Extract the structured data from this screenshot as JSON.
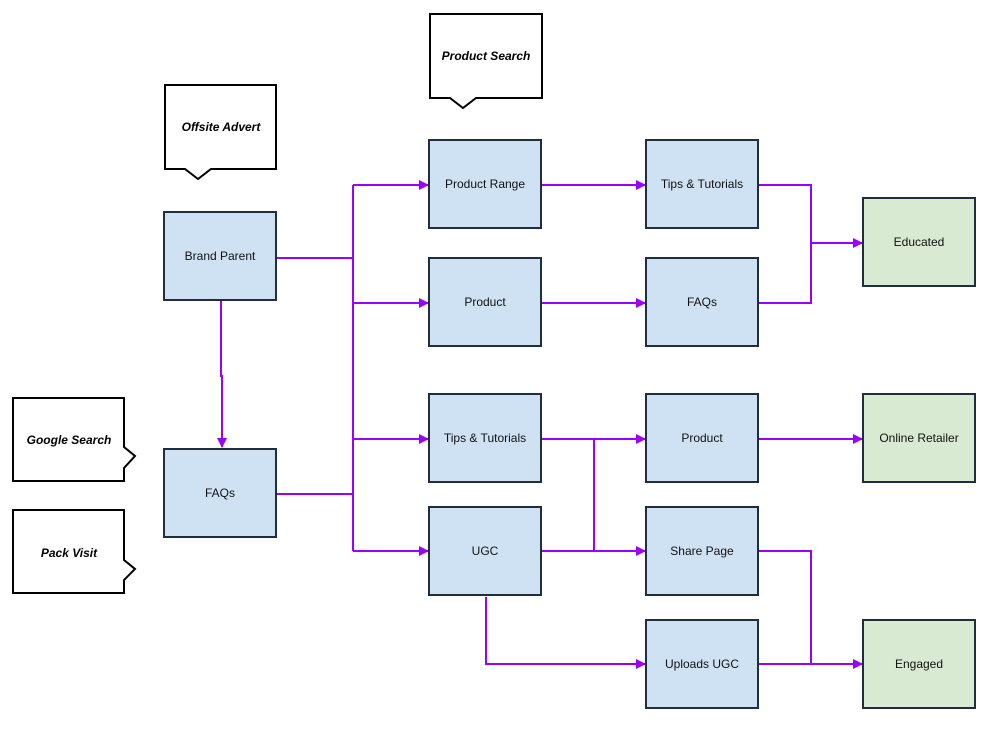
{
  "diagram": {
    "title": "",
    "colors": {
      "page_fill": "#cfe2f3",
      "outcome_fill": "#d9ead3",
      "node_stroke": "#1f2d3d",
      "callout_fill": "#ffffff",
      "callout_stroke": "#000000",
      "connector": "#9900ff"
    },
    "callouts": [
      {
        "id": "product-search",
        "label": "Product Search",
        "pointer": "down"
      },
      {
        "id": "offsite-advert",
        "label": "Offsite Advert",
        "pointer": "down"
      },
      {
        "id": "google-search",
        "label": "Google Search",
        "pointer": "right"
      },
      {
        "id": "pack-visit",
        "label": "Pack Visit",
        "pointer": "right"
      }
    ],
    "nodes": [
      {
        "id": "brand-parent",
        "label": "Brand Parent",
        "kind": "page"
      },
      {
        "id": "faqs-entry",
        "label": "FAQs",
        "kind": "page"
      },
      {
        "id": "product-range",
        "label": "Product Range",
        "kind": "page"
      },
      {
        "id": "product-1",
        "label": "Product",
        "kind": "page"
      },
      {
        "id": "tips-tutorials-1",
        "label": "Tips & Tutorials",
        "kind": "page"
      },
      {
        "id": "ugc",
        "label": "UGC",
        "kind": "page"
      },
      {
        "id": "tips-tutorials-2",
        "label": "Tips & Tutorials",
        "kind": "page"
      },
      {
        "id": "faqs-2",
        "label": "FAQs",
        "kind": "page"
      },
      {
        "id": "product-2",
        "label": "Product",
        "kind": "page"
      },
      {
        "id": "share-page",
        "label": "Share Page",
        "kind": "page"
      },
      {
        "id": "uploads-ugc",
        "label": "Uploads UGC",
        "kind": "page"
      },
      {
        "id": "educated",
        "label": "Educated",
        "kind": "outcome"
      },
      {
        "id": "online-retailer",
        "label": "Online Retailer",
        "kind": "outcome"
      },
      {
        "id": "engaged",
        "label": "Engaged",
        "kind": "outcome"
      }
    ],
    "edges": [
      {
        "from": "brand-parent",
        "to": "faqs-entry"
      },
      {
        "from": "brand-parent",
        "to": "product-range"
      },
      {
        "from": "brand-parent",
        "to": "product-1"
      },
      {
        "from": "brand-parent",
        "to": "tips-tutorials-1"
      },
      {
        "from": "brand-parent",
        "to": "ugc"
      },
      {
        "from": "faqs-entry",
        "to": "product-range"
      },
      {
        "from": "faqs-entry",
        "to": "product-1"
      },
      {
        "from": "faqs-entry",
        "to": "tips-tutorials-1"
      },
      {
        "from": "faqs-entry",
        "to": "ugc"
      },
      {
        "from": "product-range",
        "to": "tips-tutorials-2"
      },
      {
        "from": "product-1",
        "to": "faqs-2"
      },
      {
        "from": "tips-tutorials-2",
        "to": "educated"
      },
      {
        "from": "faqs-2",
        "to": "educated"
      },
      {
        "from": "tips-tutorials-1",
        "to": "product-2"
      },
      {
        "from": "tips-tutorials-1",
        "to": "share-page"
      },
      {
        "from": "ugc",
        "to": "product-2"
      },
      {
        "from": "ugc",
        "to": "share-page"
      },
      {
        "from": "ugc",
        "to": "uploads-ugc"
      },
      {
        "from": "product-2",
        "to": "online-retailer"
      },
      {
        "from": "share-page",
        "to": "engaged"
      },
      {
        "from": "uploads-ugc",
        "to": "engaged"
      }
    ]
  }
}
